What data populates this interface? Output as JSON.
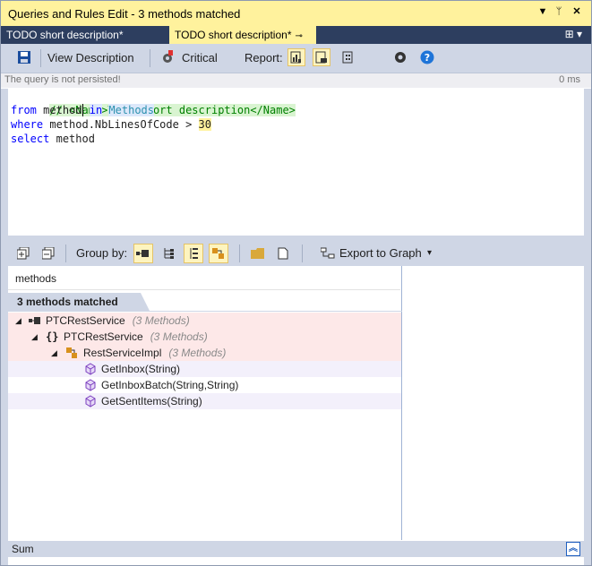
{
  "window": {
    "title": "Queries and Rules Edit  - 3 methods matched"
  },
  "tabs": [
    {
      "label": "TODO short description*",
      "active": false
    },
    {
      "label": "TODO short description*",
      "active": true
    }
  ],
  "toolbar": {
    "view_description": "View Description",
    "critical": "Critical",
    "report": "Report:"
  },
  "infobar": {
    "message": "The query is not persisted!",
    "time": "0 ms"
  },
  "code": {
    "line1_comment": "// <Name>TODO short description</Name>",
    "line2_from": "from",
    "line2_var": "method",
    "line2_in": "in",
    "line2_src": "Methods",
    "line3_where": "where",
    "line3_expr": "method.NbLinesOfCode >",
    "line3_num": "30",
    "line4_select": "select",
    "line4_var": "method"
  },
  "results_toolbar": {
    "group_by": "Group by:",
    "export": "Export to Graph"
  },
  "results": {
    "column_header": "methods",
    "matched_label": "3 methods matched",
    "tree": [
      {
        "label": "PTCRestService",
        "count": "(3 Methods)",
        "icon": "assembly-icon"
      },
      {
        "label": "PTCRestService",
        "count": "(3 Methods)",
        "icon": "namespace-icon"
      },
      {
        "label": "RestServiceImpl",
        "count": "(3 Methods)",
        "icon": "class-icon"
      },
      {
        "label": "GetInbox(String)",
        "icon": "method-icon"
      },
      {
        "label": "GetInboxBatch(String,String)",
        "icon": "method-icon"
      },
      {
        "label": "GetSentItems(String)",
        "icon": "method-icon"
      }
    ]
  },
  "status": {
    "sum_label": "Sum"
  }
}
